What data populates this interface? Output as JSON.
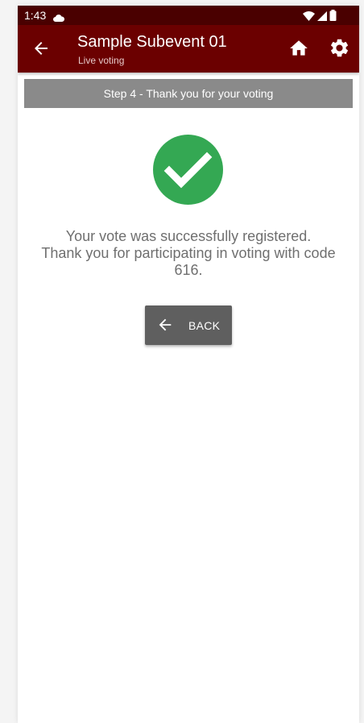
{
  "status_bar": {
    "time": "1:43",
    "icons": [
      "cloud-icon",
      "wifi-icon",
      "signal-icon",
      "battery-icon"
    ]
  },
  "app_bar": {
    "title": "Sample Subevent 01",
    "subtitle": "Live voting",
    "background_color": "#6b0000",
    "actions": [
      "back-arrow-icon",
      "home-icon",
      "gear-icon"
    ]
  },
  "step_banner": {
    "text": "Step 4 - Thank you for your voting"
  },
  "confirmation": {
    "icon": "check-circle-icon",
    "icon_color": "#34a853",
    "line1": "Your vote was successfully registered.",
    "line2": "Thank you for participating in voting with code",
    "line3": "616."
  },
  "back_button": {
    "label": "BACK",
    "icon": "arrow-left-icon"
  }
}
